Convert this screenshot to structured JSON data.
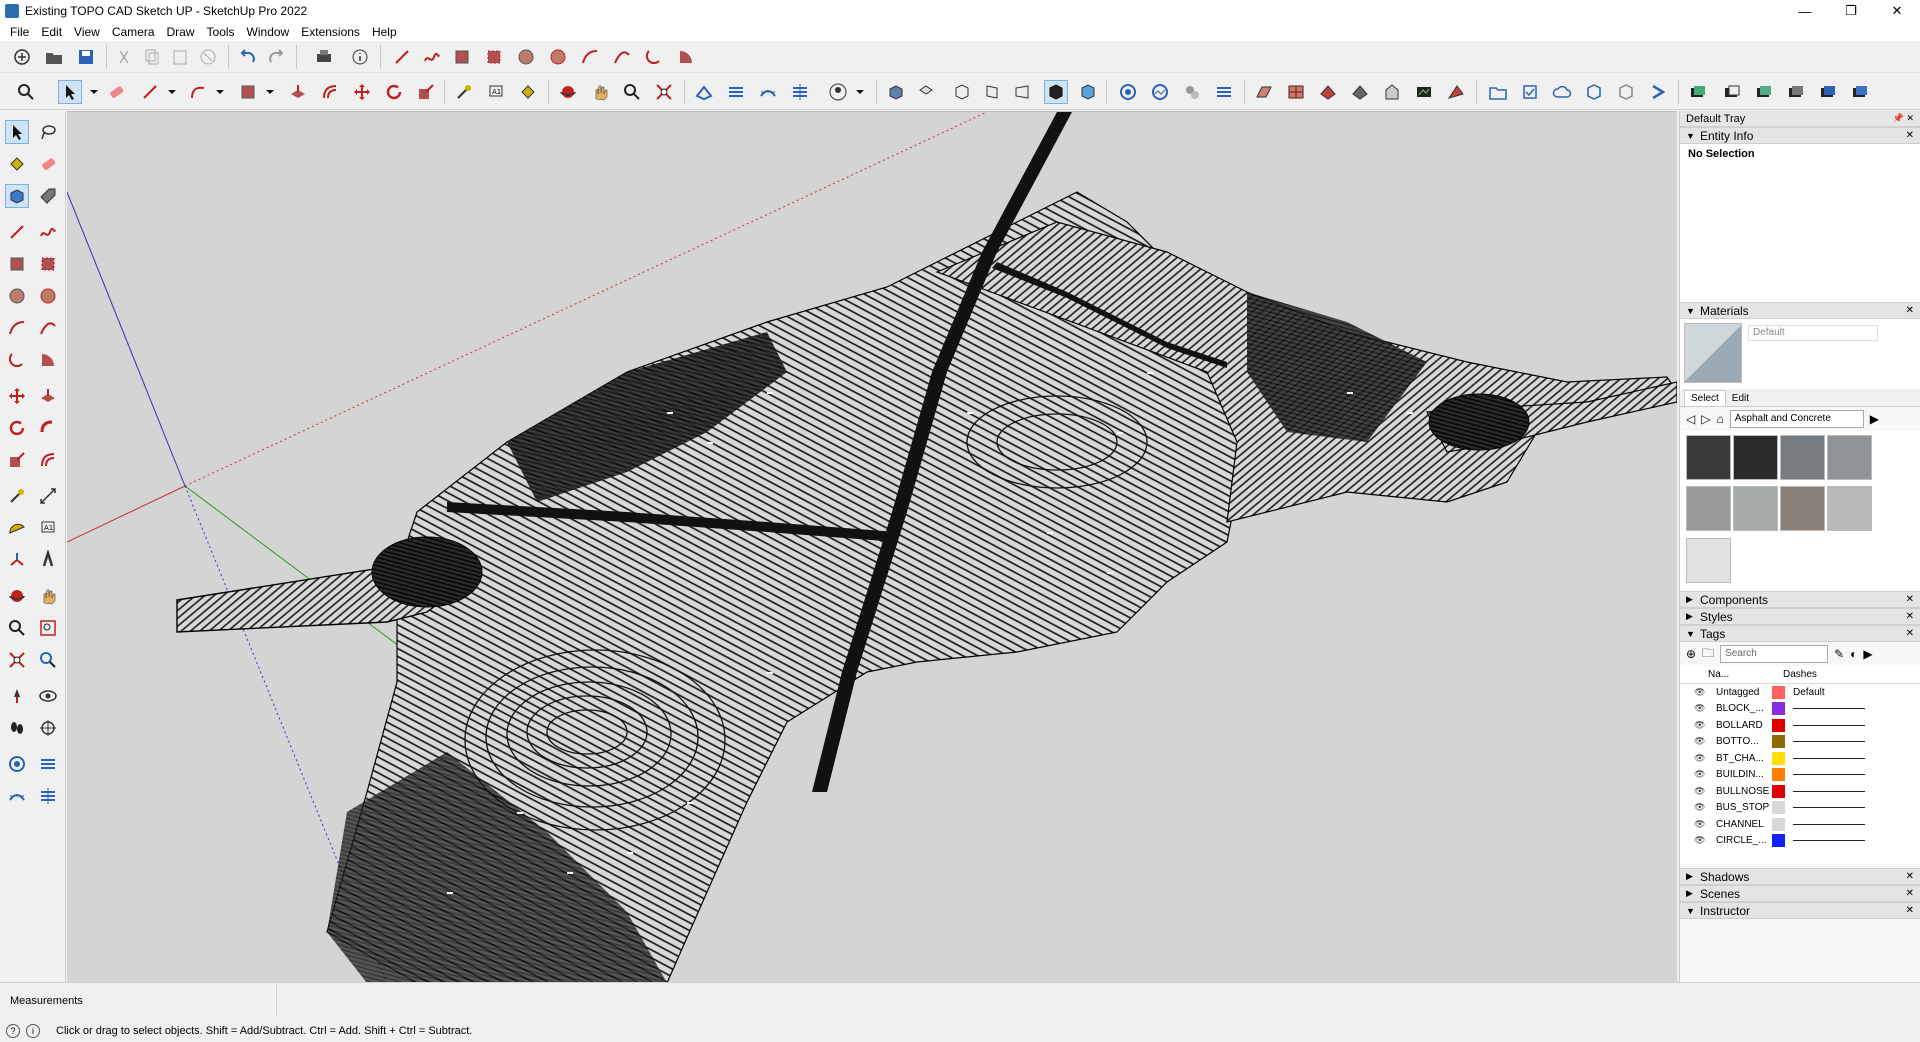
{
  "window": {
    "title": "Existing TOPO CAD Sketch UP - SketchUp Pro 2022",
    "controls": [
      "—",
      "❐",
      "✕"
    ]
  },
  "menu": [
    "File",
    "Edit",
    "View",
    "Camera",
    "Draw",
    "Tools",
    "Window",
    "Extensions",
    "Help"
  ],
  "tray": {
    "title": "Default Tray",
    "entity_info": {
      "title": "Entity Info",
      "selection": "No Selection"
    },
    "materials": {
      "title": "Materials",
      "current_name": "Default",
      "tabs": [
        "Select",
        "Edit"
      ],
      "library": "Asphalt and Concrete",
      "swatch_colors": [
        "#3a3a3a",
        "#2b2b2b",
        "#777c80",
        "#8f9396",
        "#9a9a9a",
        "#a6aaa6",
        "#8a8078",
        "#b7b9bb",
        "#e2e2e2"
      ]
    },
    "collapsed_panels": [
      "Components",
      "Styles"
    ],
    "tags": {
      "title": "Tags",
      "search_placeholder": "Search",
      "col_name": "Na...",
      "col_dashes": "Dashes",
      "rows": [
        {
          "name": "Untagged",
          "color": "#ff6060",
          "dashes": "Default"
        },
        {
          "name": "BLOCK_...",
          "color": "#8a2be2",
          "dashes": ""
        },
        {
          "name": "BOLLARD",
          "color": "#e00000",
          "dashes": ""
        },
        {
          "name": "BOTTO...",
          "color": "#8b6a00",
          "dashes": ""
        },
        {
          "name": "BT_CHA...",
          "color": "#ffe000",
          "dashes": ""
        },
        {
          "name": "BUILDIN...",
          "color": "#ff8000",
          "dashes": ""
        },
        {
          "name": "BULLNOSE",
          "color": "#e00000",
          "dashes": ""
        },
        {
          "name": "BUS_STOP",
          "color": "#d8d8d8",
          "dashes": ""
        },
        {
          "name": "CHANNEL",
          "color": "#d8d8d8",
          "dashes": ""
        },
        {
          "name": "CIRCLE_...",
          "color": "#1020ff",
          "dashes": ""
        }
      ]
    },
    "bottom_panels": [
      "Shadows",
      "Scenes",
      "Instructor"
    ]
  },
  "measurements_label": "Measurements",
  "status_message": "Click or drag to select objects. Shift = Add/Subtract. Ctrl = Add. Shift + Ctrl = Subtract."
}
